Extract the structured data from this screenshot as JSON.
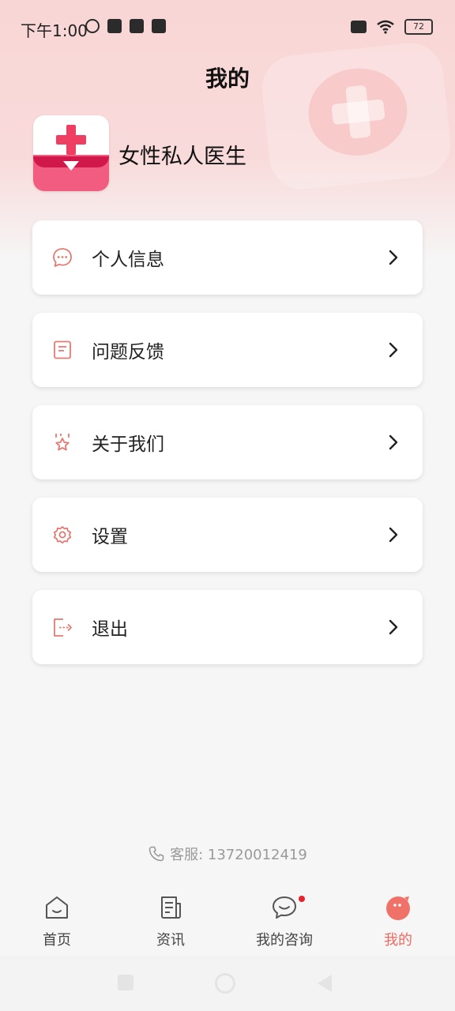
{
  "status": {
    "time": "下午1:00",
    "battery": "72"
  },
  "header": {
    "title": "我的"
  },
  "profile": {
    "app_name": "女性私人医生"
  },
  "menu": [
    {
      "label": "个人信息",
      "icon": "chat-bubble-icon"
    },
    {
      "label": "问题反馈",
      "icon": "document-icon"
    },
    {
      "label": "关于我们",
      "icon": "star-icon"
    },
    {
      "label": "设置",
      "icon": "gear-icon"
    },
    {
      "label": "退出",
      "icon": "logout-icon"
    }
  ],
  "service": {
    "text": "客服: 13720012419"
  },
  "tabs": [
    {
      "label": "首页",
      "icon": "home-icon"
    },
    {
      "label": "资讯",
      "icon": "news-icon"
    },
    {
      "label": "我的咨询",
      "icon": "consult-icon"
    },
    {
      "label": "我的",
      "icon": "mine-icon"
    }
  ],
  "colors": {
    "accent": "#ee6a60",
    "icon_stroke": "#e37b73",
    "badge": "#e8222a",
    "hero": "#f9d6d6"
  }
}
